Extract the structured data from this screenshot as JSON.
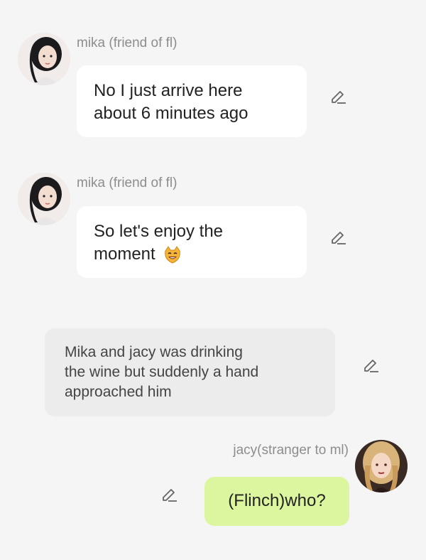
{
  "messages": [
    {
      "sender": "mika (friend of fl)",
      "text_line1": "No I just arrive here",
      "text_line2": "about 6 minutes ago",
      "avatar_icon": "female-avatar-dark-hair",
      "edit_icon": "pencil-icon"
    },
    {
      "sender": "mika (friend of fl)",
      "text_line1": "So let's enjoy the",
      "text_line2": "moment",
      "emoji": "cat-smile-emoji",
      "avatar_icon": "female-avatar-dark-hair",
      "edit_icon": "pencil-icon"
    },
    {
      "type": "narration",
      "line1": "Mika and jacy was drinking",
      "line2": "the wine but suddenly a hand",
      "line3": "approached him",
      "edit_icon": "pencil-icon"
    },
    {
      "sender": "jacy(stranger to ml)",
      "text": "(Flinch)who?",
      "avatar_icon": "female-avatar-blonde",
      "edit_icon": "pencil-icon"
    }
  ],
  "colors": {
    "background": "#f5f5f5",
    "bubble_white": "#ffffff",
    "bubble_gray": "#ececec",
    "bubble_green": "#dcf6a0",
    "sender_text": "#8d8d8d"
  }
}
